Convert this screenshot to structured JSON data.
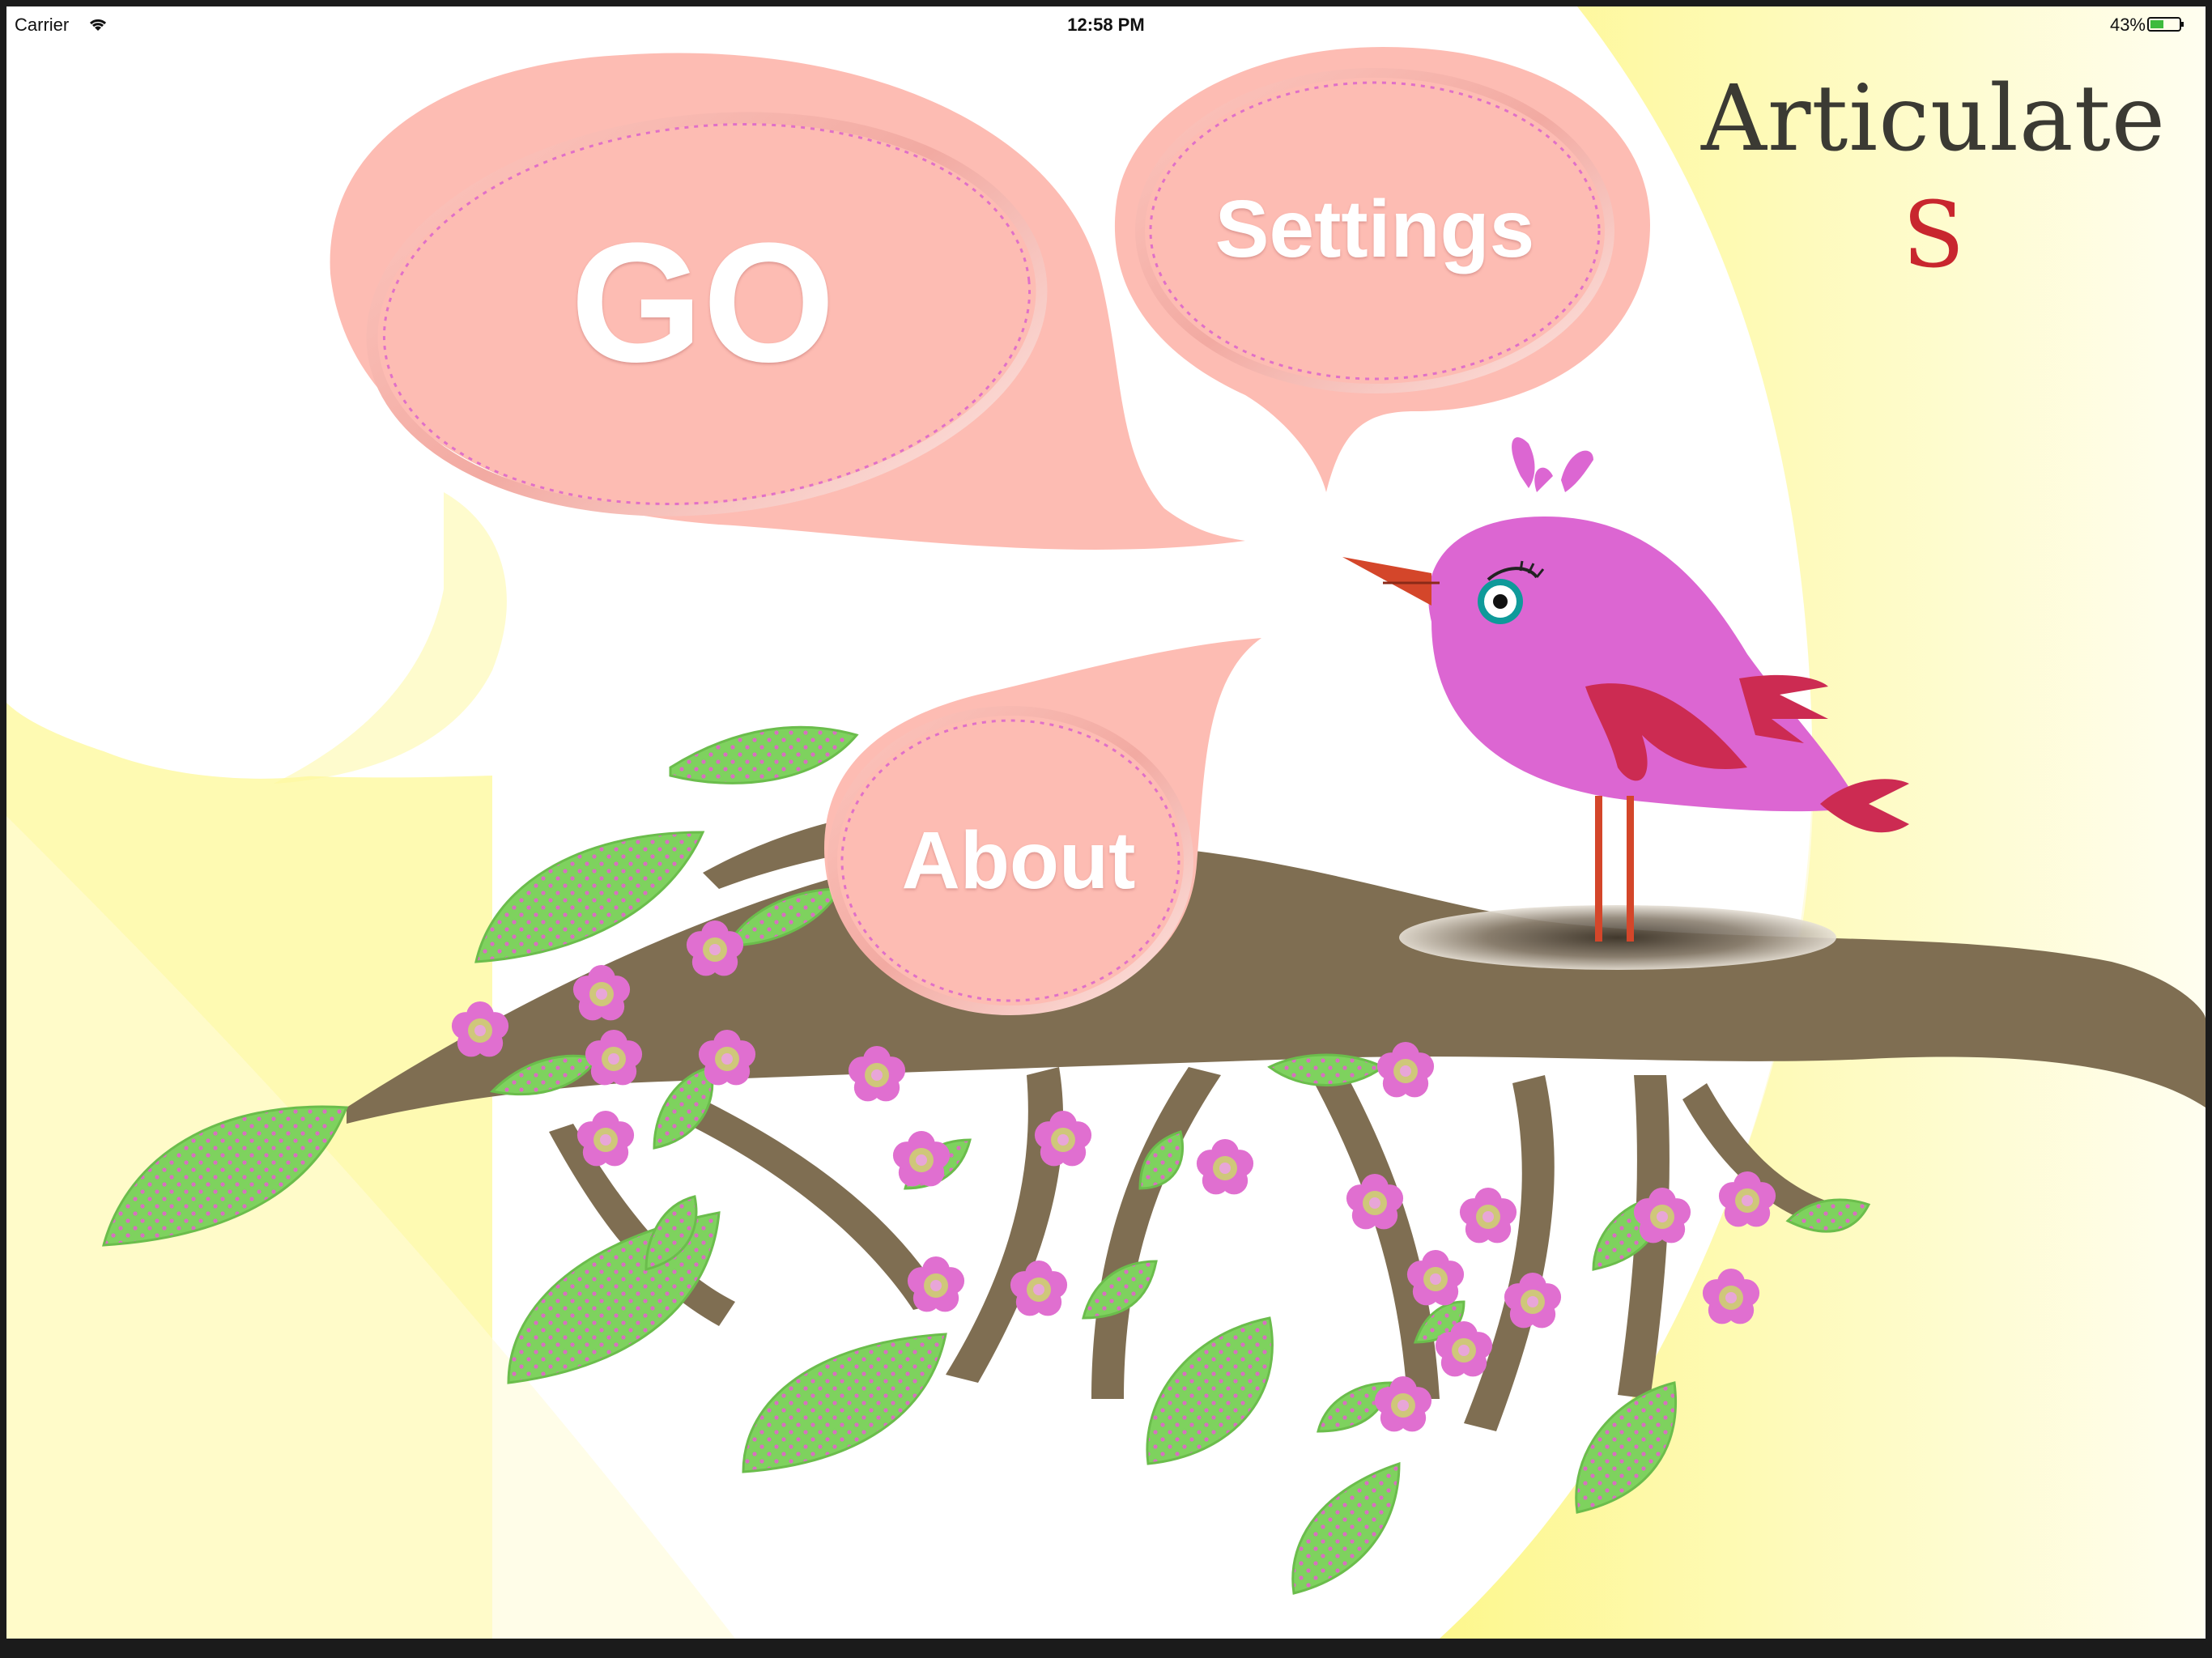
{
  "status_bar": {
    "carrier": "Carrier",
    "time": "12:58 PM",
    "battery": "43%",
    "wifi_icon": "wifi-icon",
    "battery_icon": "battery-icon"
  },
  "app": {
    "title": "Articulate",
    "title_letter": "S"
  },
  "menu": {
    "go_label": "GO",
    "settings_label": "Settings",
    "about_label": "About"
  },
  "colors": {
    "bubble": "#fdbcb3",
    "bubble_dots": "#e070c8",
    "background_yellow": "#fdf98f",
    "branch": "#7f6e52",
    "leaf": "#7ed25e",
    "blossom": "#e06fd0",
    "bird_body": "#dc66d2",
    "bird_wing": "#cc2b52",
    "bird_beak": "#d4462a",
    "title_letter": "#c8262e"
  }
}
